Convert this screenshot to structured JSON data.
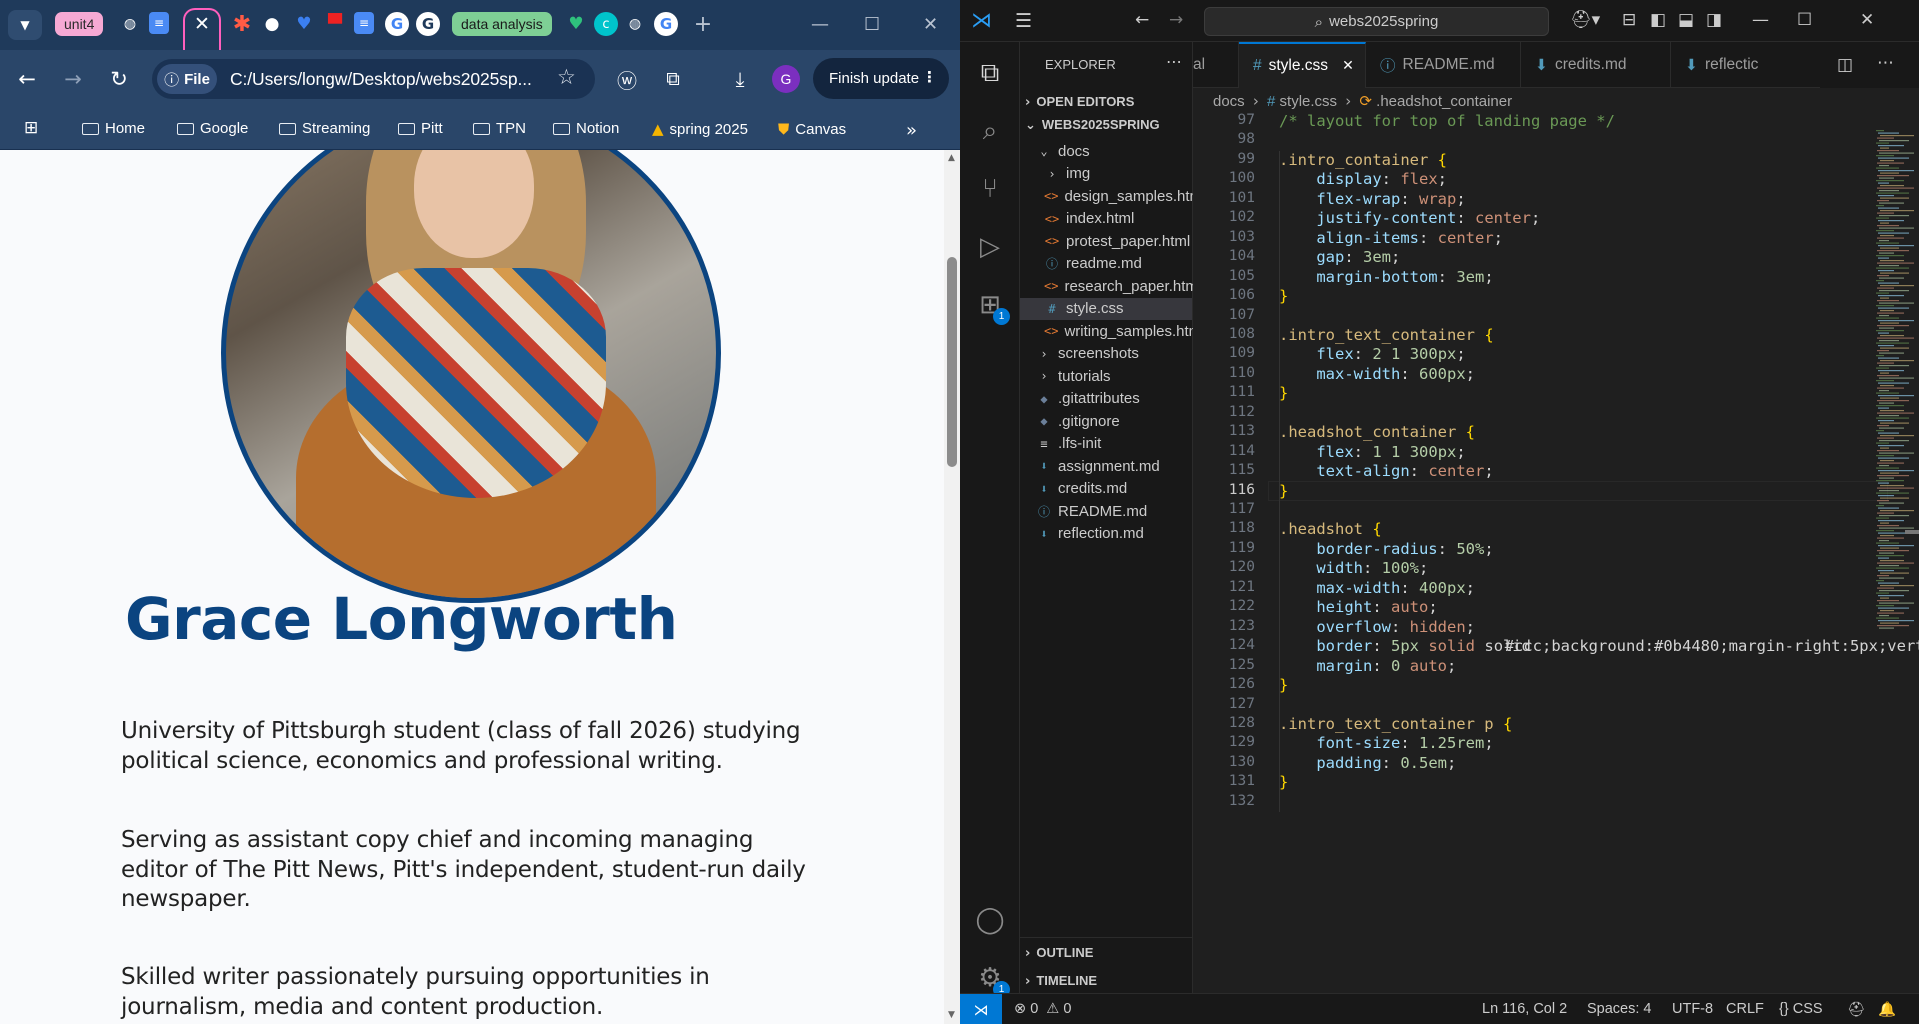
{
  "browser": {
    "tabs": [
      {
        "label": "unit4",
        "color": "#f6a9d4"
      },
      {
        "label": "data analysis",
        "color": "#7ecf95"
      }
    ],
    "site_chip": "File",
    "url": "C:/Users/longw/Desktop/webs2025sp...",
    "finish_update": "Finish update",
    "profile_initial": "G",
    "bookmarks": [
      "Home",
      "Google",
      "Streaming",
      "Pitt",
      "TPN",
      "Notion",
      "spring 2025",
      "Canvas"
    ],
    "page": {
      "name": "Grace Longworth",
      "paragraphs": [
        "University of Pittsburgh student (class of fall 2026) studying political science, economics and professional writing.",
        "Serving as assistant copy chief and incoming managing editor of The Pitt News, Pitt's independent, student-run daily newspaper.",
        "Skilled writer passionately pursuing opportunities in journalism, media and content production."
      ]
    }
  },
  "vscode": {
    "search": "webs2025spring",
    "explorer_title": "EXPLORER",
    "sections": {
      "open_editors": "OPEN EDITORS",
      "project": "WEBS2025SPRING",
      "outline": "OUTLINE",
      "timeline": "TIMELINE"
    },
    "tree": [
      {
        "label": "docs",
        "kind": "folder-open",
        "depth": 1
      },
      {
        "label": "img",
        "kind": "folder",
        "depth": 2
      },
      {
        "label": "design_samples.html",
        "kind": "html",
        "depth": 2
      },
      {
        "label": "index.html",
        "kind": "html",
        "depth": 2
      },
      {
        "label": "protest_paper.html",
        "kind": "html",
        "depth": 2
      },
      {
        "label": "readme.md",
        "kind": "info",
        "depth": 2
      },
      {
        "label": "research_paper.html",
        "kind": "html",
        "depth": 2
      },
      {
        "label": "style.css",
        "kind": "css",
        "depth": 2,
        "selected": true
      },
      {
        "label": "writing_samples.html",
        "kind": "html",
        "depth": 2
      },
      {
        "label": "screenshots",
        "kind": "folder",
        "depth": 1
      },
      {
        "label": "tutorials",
        "kind": "folder",
        "depth": 1
      },
      {
        "label": ".gitattributes",
        "kind": "git",
        "depth": 1
      },
      {
        "label": ".gitignore",
        "kind": "git",
        "depth": 1
      },
      {
        "label": ".lfs-init",
        "kind": "text",
        "depth": 1
      },
      {
        "label": "assignment.md",
        "kind": "md",
        "depth": 1
      },
      {
        "label": "credits.md",
        "kind": "md",
        "depth": 1
      },
      {
        "label": "README.md",
        "kind": "info",
        "depth": 1
      },
      {
        "label": "reflection.md",
        "kind": "md",
        "depth": 1
      }
    ],
    "editor_tabs": [
      {
        "label": "al",
        "icon": ""
      },
      {
        "label": "style.css",
        "icon": "#",
        "active": true
      },
      {
        "label": "README.md",
        "icon": "ⓘ"
      },
      {
        "label": "credits.md",
        "icon": "⬇"
      },
      {
        "label": "reflectic",
        "icon": "⬇"
      }
    ],
    "breadcrumb": [
      "docs",
      "style.css",
      ".headshot_container"
    ],
    "lines": [
      {
        "n": "97",
        "t": "/* layout for top of landing page */"
      },
      {
        "n": "98",
        "t": ""
      },
      {
        "n": "99",
        "t": ".intro_container {"
      },
      {
        "n": "100",
        "t": "    display: flex;"
      },
      {
        "n": "101",
        "t": "    flex-wrap: wrap;"
      },
      {
        "n": "102",
        "t": "    justify-content: center;"
      },
      {
        "n": "103",
        "t": "    align-items: center;"
      },
      {
        "n": "104",
        "t": "    gap: 3em;"
      },
      {
        "n": "105",
        "t": "    margin-bottom: 3em;"
      },
      {
        "n": "106",
        "t": "}"
      },
      {
        "n": "107",
        "t": ""
      },
      {
        "n": "108",
        "t": ".intro_text_container {"
      },
      {
        "n": "109",
        "t": "    flex: 2 1 300px;"
      },
      {
        "n": "110",
        "t": "    max-width: 600px;"
      },
      {
        "n": "111",
        "t": "}"
      },
      {
        "n": "112",
        "t": ""
      },
      {
        "n": "113",
        "t": ".headshot_container {"
      },
      {
        "n": "114",
        "t": "    flex: 1 1 300px;"
      },
      {
        "n": "115",
        "t": "    text-align: center;"
      },
      {
        "n": "116",
        "t": "}"
      },
      {
        "n": "117",
        "t": ""
      },
      {
        "n": "118",
        "t": ".headshot {"
      },
      {
        "n": "119",
        "t": "    border-radius: 50%;"
      },
      {
        "n": "120",
        "t": "    width: 100%;"
      },
      {
        "n": "121",
        "t": "    max-width: 400px;"
      },
      {
        "n": "122",
        "t": "    height: auto;"
      },
      {
        "n": "123",
        "t": "    overflow: hidden;"
      },
      {
        "n": "124",
        "t": "    border: 5px solid #0b4480;"
      },
      {
        "n": "125",
        "t": "    margin: 0 auto;"
      },
      {
        "n": "126",
        "t": "}"
      },
      {
        "n": "127",
        "t": ""
      },
      {
        "n": "128",
        "t": ".intro_text_container p {"
      },
      {
        "n": "129",
        "t": "    font-size: 1.25rem;"
      },
      {
        "n": "130",
        "t": "    padding: 0.5em;"
      },
      {
        "n": "131",
        "t": "}"
      },
      {
        "n": "132",
        "t": ""
      }
    ],
    "current_line": "116",
    "status": {
      "problems": "0",
      "warnings": "0",
      "position": "Ln 116, Col 2",
      "spaces": "Spaces: 4",
      "encoding": "UTF-8",
      "eol": "CRLF",
      "language": "CSS"
    },
    "activity_badge": "1",
    "accent": "#0078d4",
    "headshot_border": "#0b4480"
  }
}
